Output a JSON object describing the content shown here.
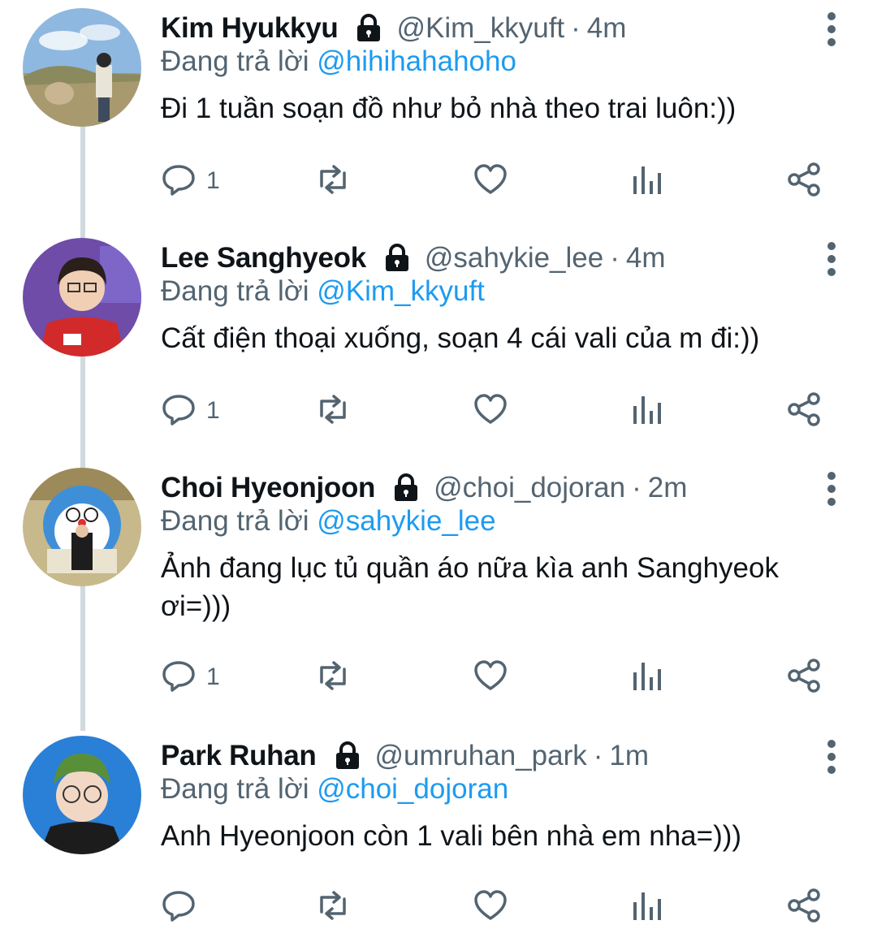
{
  "tweets": [
    {
      "name": "Kim Hyukkyu",
      "handle": "@Kim_kkyuft",
      "dot": "·",
      "time": "4m",
      "replying_prefix": "Đang trả lời",
      "replying_to": "@hihihahahoho",
      "text": "Đi 1 tuần soạn đồ như bỏ nhà theo trai luôn:))",
      "reply_count": "1",
      "locked": true
    },
    {
      "name": "Lee Sanghyeok",
      "handle": "@sahykie_lee",
      "dot": "·",
      "time": "4m",
      "replying_prefix": "Đang trả lời",
      "replying_to": "@Kim_kkyuft",
      "text": "Cất điện thoại xuống, soạn 4 cái vali của m đi:))",
      "reply_count": "1",
      "locked": true
    },
    {
      "name": "Choi Hyeonjoon",
      "handle": "@choi_dojoran",
      "dot": "·",
      "time": "2m",
      "replying_prefix": "Đang trả lời",
      "replying_to": "@sahykie_lee",
      "text": "Ảnh đang lục tủ quần áo nữa kìa anh Sanghyeok ơi=)))",
      "reply_count": "1",
      "locked": true
    },
    {
      "name": "Park Ruhan",
      "handle": "@umruhan_park",
      "dot": "·",
      "time": "1m",
      "replying_prefix": "Đang trả lời",
      "replying_to": "@choi_dojoran",
      "text": "Anh Hyeonjoon còn 1 vali bên nhà em nha=)))",
      "reply_count": "",
      "locked": true
    }
  ],
  "icons": [
    "lock-icon",
    "more-icon",
    "reply-icon",
    "retweet-icon",
    "like-icon",
    "analytics-icon",
    "share-icon"
  ],
  "colors": {
    "text": "#0f1419",
    "secondary": "#536471",
    "mention": "#1d9bf0",
    "thread_line": "#cfd9de"
  }
}
